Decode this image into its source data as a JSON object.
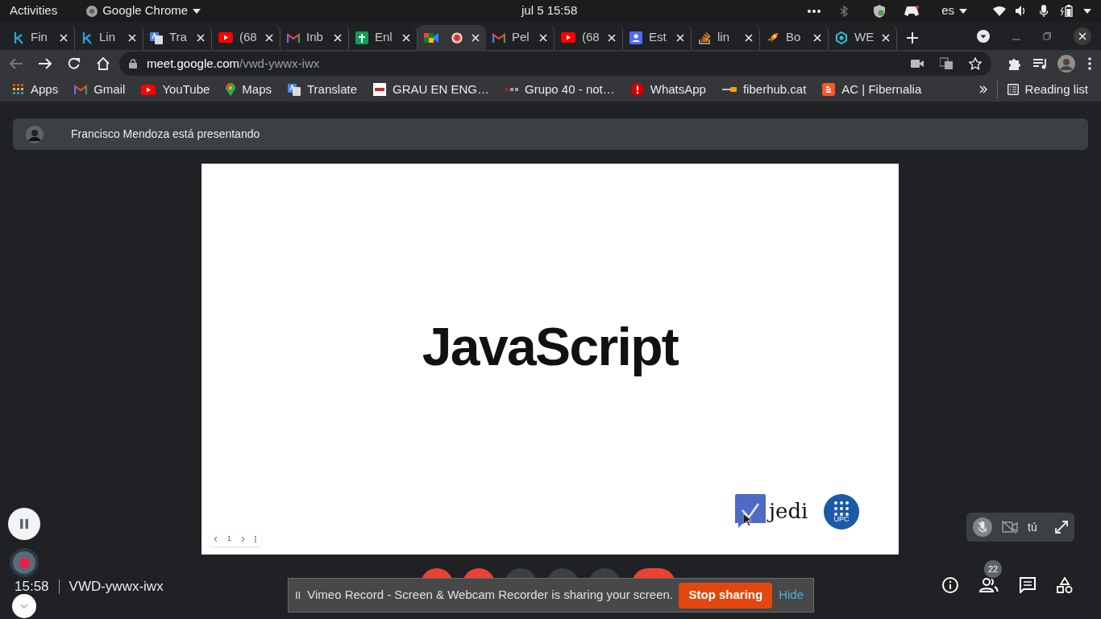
{
  "top_bar": {
    "activities": "Activities",
    "app_menu": "Google Chrome",
    "clock": "jul 5  15:58",
    "language": "es"
  },
  "tabs": [
    {
      "title": "Fin",
      "selected": false
    },
    {
      "title": "Lin",
      "selected": false
    },
    {
      "title": "Tra",
      "selected": false
    },
    {
      "title": "(68",
      "selected": false
    },
    {
      "title": "Inb",
      "selected": false
    },
    {
      "title": "Enl",
      "selected": false
    },
    {
      "recording": true,
      "selected": true
    },
    {
      "title": "Pel",
      "selected": false
    },
    {
      "title": "(68",
      "selected": false
    },
    {
      "title": "Est",
      "selected": false
    },
    {
      "title": "lin",
      "selected": false
    },
    {
      "title": "Bo",
      "selected": false
    },
    {
      "title": "WE",
      "selected": false
    }
  ],
  "address_bar": {
    "host": "meet.google.com",
    "path": "/vwd-ywwx-iwx"
  },
  "bookmarks": [
    "Apps",
    "Gmail",
    "YouTube",
    "Maps",
    "Translate",
    "GRAU EN ENG…",
    "Grupo 40 - not…",
    "WhatsApp",
    "fiberhub.cat",
    "AC | Fibernalia"
  ],
  "reading_list": "Reading list",
  "presenter_banner": "Francisco Mendoza está presentando",
  "slide": {
    "title": "JavaScript",
    "page": "1",
    "logos": [
      "jedi",
      "UPC"
    ]
  },
  "self_tile": {
    "label": "tú",
    "mic_muted": true,
    "camera_off": true
  },
  "meeting": {
    "time": "15:58",
    "code": "VWD-ywwx-iwx",
    "participants": "22"
  },
  "share_banner": {
    "icon": "II",
    "message": "Vimeo Record - Screen & Webcam Recorder is sharing your screen.",
    "stop": "Stop sharing",
    "hide": "Hide"
  }
}
